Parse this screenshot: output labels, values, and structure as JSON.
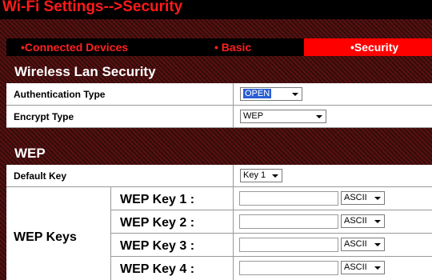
{
  "page": {
    "title": "Wi-Fi Settings-->Security"
  },
  "tabs": [
    {
      "label": "•Connected Devices",
      "active": false
    },
    {
      "label": "• Basic",
      "active": false
    },
    {
      "label": "•Security",
      "active": true
    }
  ],
  "wireless_lan_security": {
    "heading": "Wireless Lan Security",
    "authentication_type": {
      "label": "Authentication Type",
      "value": "OPEN"
    },
    "encrypt_type": {
      "label": "Encrypt Type",
      "value": "WEP"
    }
  },
  "wep": {
    "heading": "WEP",
    "default_key": {
      "label": "Default Key",
      "value": "Key 1"
    },
    "wep_keys": {
      "label": "WEP Keys",
      "keys": [
        {
          "label": "WEP Key 1 :",
          "value": "",
          "format": "ASCII"
        },
        {
          "label": "WEP Key 2 :",
          "value": "",
          "format": "ASCII"
        },
        {
          "label": "WEP Key 3 :",
          "value": "",
          "format": "ASCII"
        },
        {
          "label": "WEP Key 4 :",
          "value": "",
          "format": "ASCII"
        }
      ]
    }
  },
  "colors": {
    "accent": "#ff0000",
    "title_text": "#ff1a1a",
    "tab_bar": "#000000",
    "background": "#2b0d0d"
  }
}
